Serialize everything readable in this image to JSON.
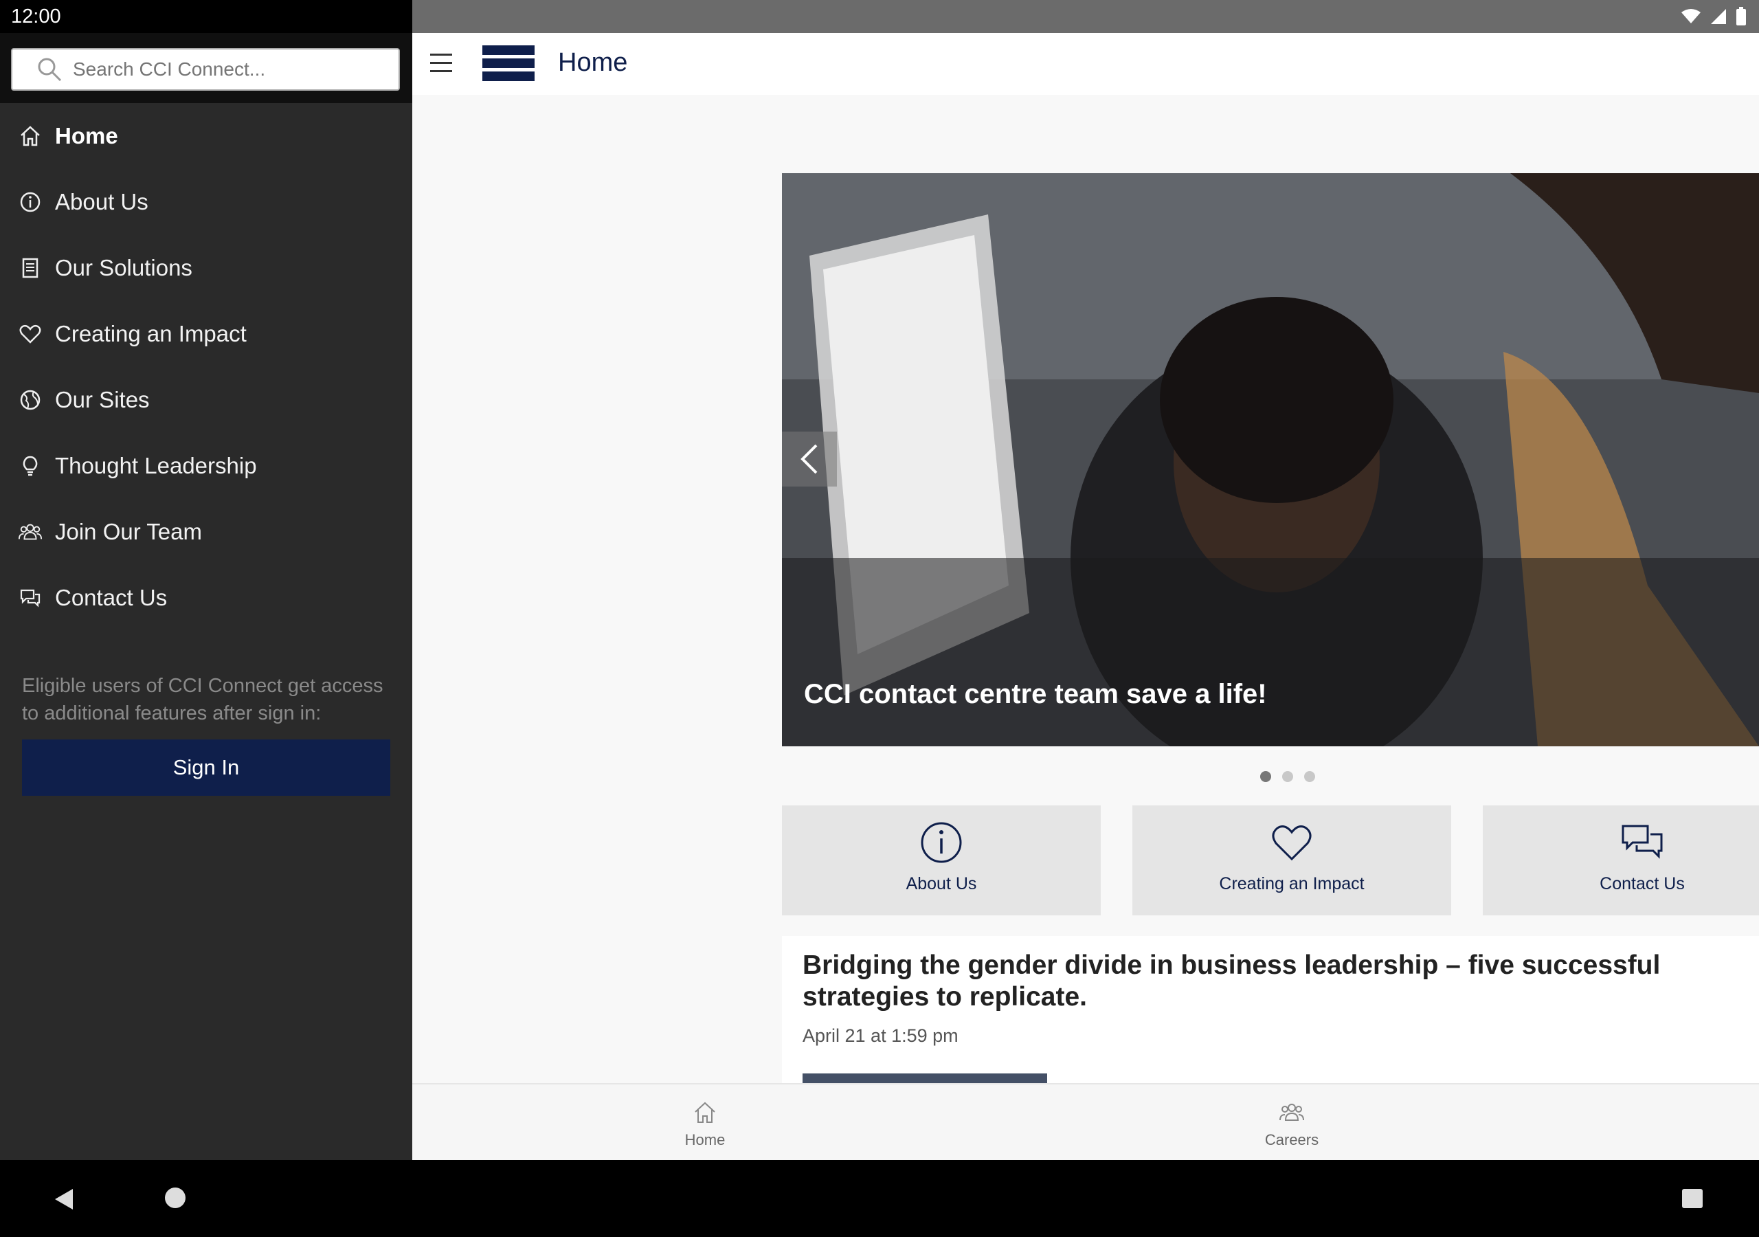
{
  "status_bar": {
    "time": "12:00"
  },
  "drawer": {
    "search_placeholder": "Search CCI Connect...",
    "items": [
      {
        "label": "Home",
        "icon": "home-icon"
      },
      {
        "label": "About Us",
        "icon": "info-icon"
      },
      {
        "label": "Our Solutions",
        "icon": "document-icon"
      },
      {
        "label": "Creating an Impact",
        "icon": "heart-icon"
      },
      {
        "label": "Our Sites",
        "icon": "globe-icon"
      },
      {
        "label": "Thought Leadership",
        "icon": "lightbulb-icon"
      },
      {
        "label": "Join Our Team",
        "icon": "team-icon"
      },
      {
        "label": "Contact Us",
        "icon": "chat-icon"
      }
    ],
    "note": "Eligible users of CCI Connect get access to additional features after sign in:",
    "sign_in": "Sign In"
  },
  "app_bar": {
    "title": "Home"
  },
  "carousel": {
    "caption": "CCI contact centre team save a life!",
    "slide_count": 3,
    "active_index": 0
  },
  "tiles": [
    {
      "label": "About Us",
      "icon": "info-icon"
    },
    {
      "label": "Creating an Impact",
      "icon": "heart-icon"
    },
    {
      "label": "Contact Us",
      "icon": "chat-icon"
    }
  ],
  "news": {
    "title": "Bridging the gender divide in business leadership – five successful strategies to replicate.",
    "date": "April 21 at 1:59 pm"
  },
  "bottom_nav": [
    {
      "label": "Home",
      "icon": "home-icon"
    },
    {
      "label": "Careers",
      "icon": "team-icon"
    }
  ],
  "colors": {
    "brand_navy": "#0f1f4b",
    "drawer_bg": "#2a2a2a"
  }
}
